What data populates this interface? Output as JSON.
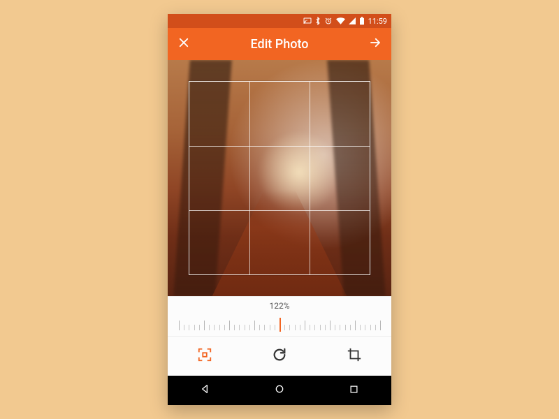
{
  "status": {
    "time": "11:59",
    "icons": [
      "cast",
      "bluetooth",
      "alarm",
      "wifi",
      "signal",
      "battery"
    ]
  },
  "header": {
    "title": "Edit Photo",
    "close_label": "Close",
    "next_label": "Next"
  },
  "zoom": {
    "readout": "122%"
  },
  "tools": {
    "frame_label": "Frame",
    "rotate_label": "Rotate",
    "crop_label": "Crop",
    "active": "frame"
  },
  "nav": {
    "back": "Back",
    "home": "Home",
    "recents": "Recents"
  },
  "colors": {
    "accent": "#f26522",
    "accent_dark": "#d24e1a"
  }
}
